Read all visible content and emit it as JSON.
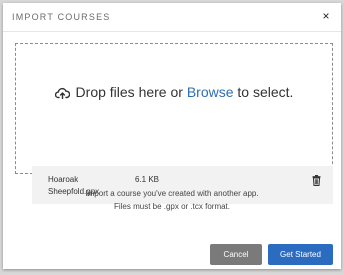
{
  "dialog": {
    "title": "IMPORT COURSES",
    "close_label": "×"
  },
  "dropzone": {
    "prefix": "Drop files here or ",
    "browse_label": "Browse",
    "suffix": " to select.",
    "icon": "cloud-upload-icon"
  },
  "files": [
    {
      "name": "Hoaroak Sheepfold.gpx",
      "size": "6.1 KB",
      "remove_icon": "trash-icon"
    }
  ],
  "help": {
    "line1": "Import a course you've created with another app.",
    "line2": "Files must be .gpx or .tcx format."
  },
  "footer": {
    "cancel_label": "Cancel",
    "start_label": "Get Started"
  },
  "colors": {
    "accent": "#2b6cc0",
    "link": "#2f6fb0",
    "cancel": "#7a7a7a"
  }
}
